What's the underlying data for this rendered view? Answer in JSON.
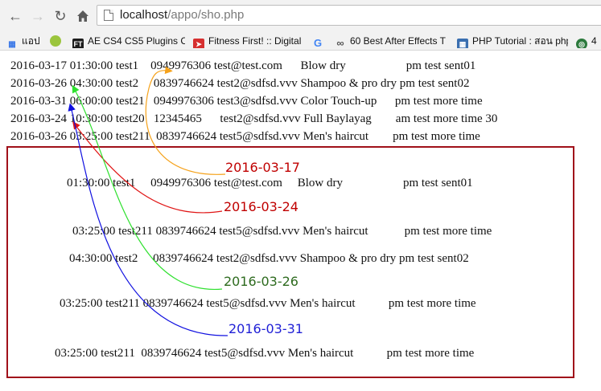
{
  "browser": {
    "back_icon": "back-arrow-icon",
    "forward_icon": "forward-arrow-icon",
    "reload_icon": "reload-icon",
    "home_icon": "home-icon",
    "url_host": "localhost",
    "url_path": "/appo/sho.php"
  },
  "bookmarks": [
    {
      "label": "แอป",
      "icon": "apps-grid-icon",
      "color": "#3b78e7"
    },
    {
      "label": "",
      "icon": "tennis-ball-icon",
      "color": "#9bc53d"
    },
    {
      "label": "AE CS4 CS5 Plugins C",
      "icon": "ft-logo-icon",
      "color": "#1d1d1d"
    },
    {
      "label": "Fitness First! :: Digital",
      "icon": "rocket-icon",
      "color": "#d62f2f"
    },
    {
      "label": "",
      "icon": "google-g-icon",
      "color": "#4285f4"
    },
    {
      "label": "60 Best After Effects T",
      "icon": "swirl-icon",
      "color": "#555555"
    },
    {
      "label": "PHP Tutorial : สอน php",
      "icon": "php-book-icon",
      "color": "#3a6fb0"
    },
    {
      "label": "4",
      "icon": "target-icon",
      "color": "#2c7a3d"
    }
  ],
  "top_rows": [
    "2016-03-17 01:30:00 test1    0949976306 test@test.com      Blow dry                    pm test sent01",
    "2016-03-26 04:30:00 test2     0839746624 test2@sdfsd.vvv Shampoo & pro dry pm test sent02",
    "2016-03-31 06:00:00 test21   0949976306 test3@sdfsd.vvv Color Touch-up      pm test more time",
    "2016-03-24 10:30:00 test20   12345465      test2@sdfsd.vvv Full Baylayag        am test more time 30",
    "2016-03-26 03:25:00 test211  0839746624 test5@sdfsd.vvv Men's haircut        pm test more time"
  ],
  "grouped_rows": [
    "01:30:00 test1     0949976306 test@test.com     Blow dry                    pm test sent01",
    "03:25:00 test211 0839746624 test5@sdfsd.vvv Men's haircut            pm test more time",
    "04:30:00 test2     0839746624 test2@sdfsd.vvv Shampoo & pro dry pm test sent02",
    "03:25:00 test211 0839746624 test5@sdfsd.vvv Men's haircut           pm test more time",
    "03:25:00 test211  0839746624 test5@sdfsd.vvv Men's haircut           pm test more time"
  ],
  "date_labels": [
    {
      "text": "2016-03-17",
      "color": "#c00000"
    },
    {
      "text": "2016-03-24",
      "color": "#c00000"
    },
    {
      "text": "2016-03-26",
      "color": "#2e6b1f"
    },
    {
      "text": "2016-03-31",
      "color": "#1f1fd6"
    }
  ],
  "colors": {
    "box_border": "#a0101a",
    "arrow_orange": "#f5a21b",
    "arrow_red": "#e01515",
    "arrow_green": "#2ee02e",
    "arrow_blue": "#1010e0"
  }
}
